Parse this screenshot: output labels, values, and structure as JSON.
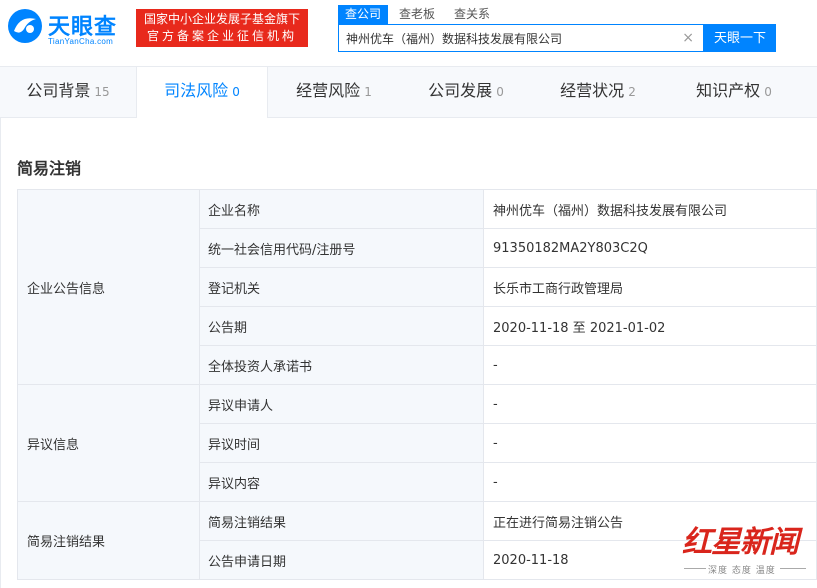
{
  "header": {
    "logo_name": "天眼查",
    "logo_url": "TianYanCha.com",
    "promo_line1": "国家中小企业发展子基金旗下",
    "promo_line2": "官方备案企业征信机构",
    "search_tabs": [
      "查公司",
      "查老板",
      "查关系"
    ],
    "search_value": "神州优车（福州）数据科技发展有限公司",
    "clear_symbol": "×",
    "search_button": "天眼一下",
    "brand_color": "#0084ff",
    "promo_color": "#e8291c"
  },
  "nav": {
    "tabs": [
      {
        "label": "公司背景",
        "count": "15"
      },
      {
        "label": "司法风险",
        "count": "0"
      },
      {
        "label": "经营风险",
        "count": "1"
      },
      {
        "label": "公司发展",
        "count": "0"
      },
      {
        "label": "经营状况",
        "count": "2"
      },
      {
        "label": "知识产权",
        "count": "0"
      }
    ],
    "active_index": 1
  },
  "section": {
    "title": "简易注销"
  },
  "table": {
    "groups": [
      {
        "name": "企业公告信息",
        "rows": [
          {
            "label": "企业名称",
            "value": "神州优车（福州）数据科技发展有限公司"
          },
          {
            "label": "统一社会信用代码/注册号",
            "value": "91350182MA2Y803C2Q"
          },
          {
            "label": "登记机关",
            "value": "长乐市工商行政管理局"
          },
          {
            "label": "公告期",
            "value": "2020-11-18 至 2021-01-02"
          },
          {
            "label": "全体投资人承诺书",
            "value": "-"
          }
        ]
      },
      {
        "name": "异议信息",
        "rows": [
          {
            "label": "异议申请人",
            "value": "-"
          },
          {
            "label": "异议时间",
            "value": "-"
          },
          {
            "label": "异议内容",
            "value": "-"
          }
        ]
      },
      {
        "name": "简易注销结果",
        "rows": [
          {
            "label": "简易注销结果",
            "value": "正在进行简易注销公告"
          },
          {
            "label": "公告申请日期",
            "value": "2020-11-18"
          }
        ]
      }
    ]
  },
  "watermark": {
    "text": "红星新闻",
    "subtext": "深度 态度 温度"
  }
}
